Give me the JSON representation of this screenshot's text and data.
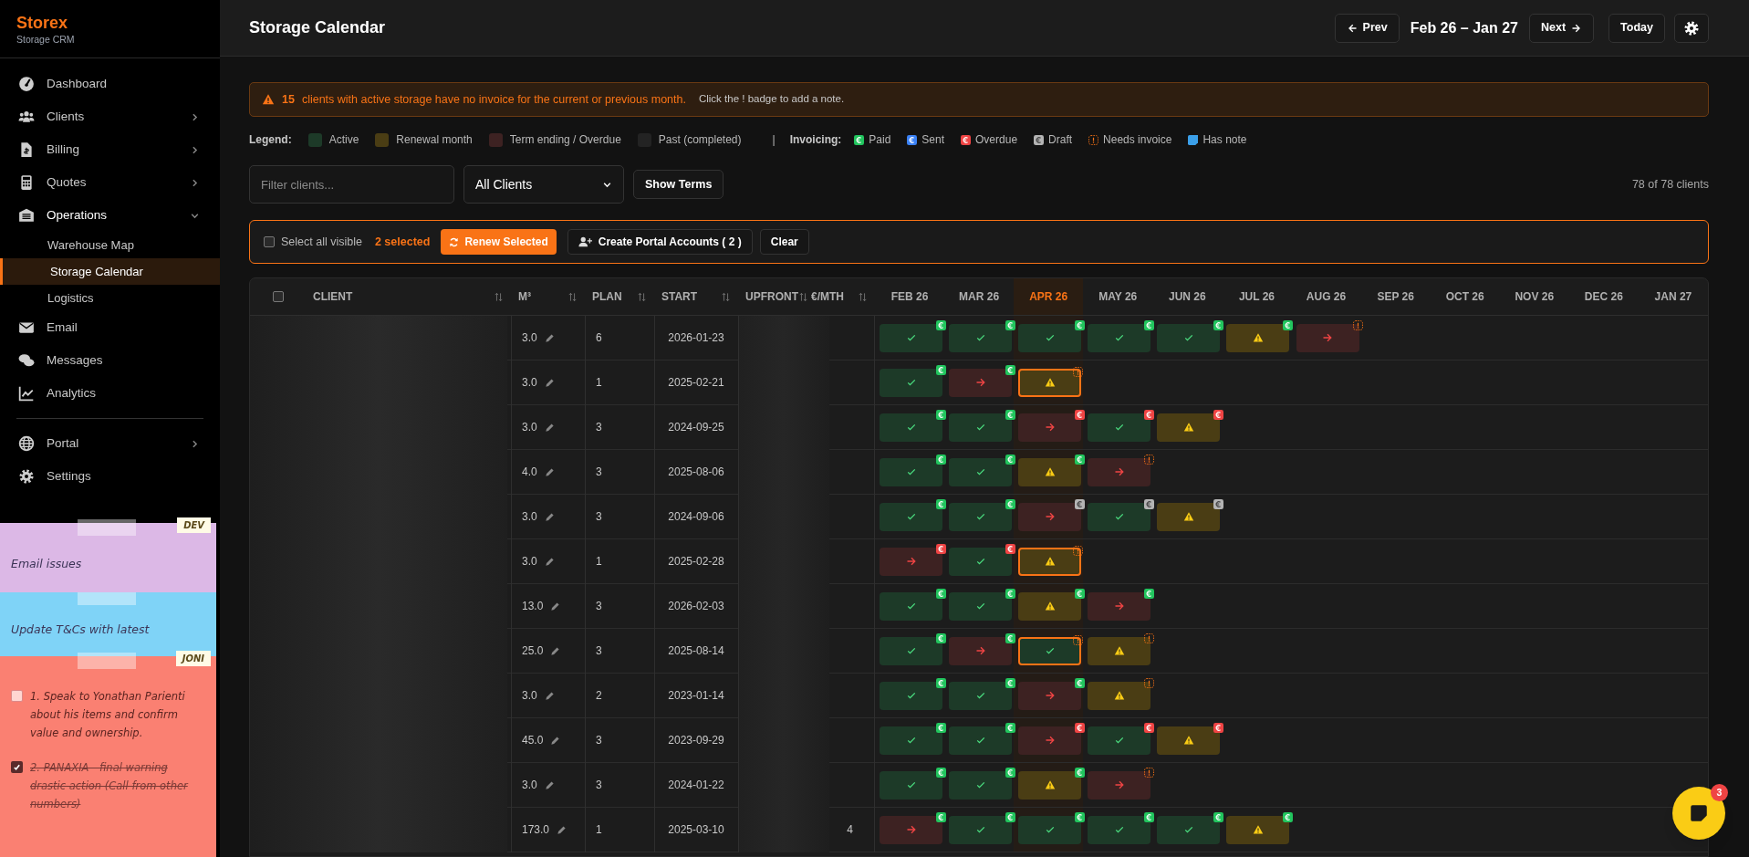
{
  "sidebar": {
    "brand": "Storex",
    "subtitle": "Storage CRM",
    "groups": [
      {
        "items": [
          {
            "label": "Dashboard",
            "selected": false
          },
          {
            "label": "Clients",
            "selected": false,
            "expanded": false
          },
          {
            "label": "Billing",
            "selected": false,
            "expanded": false
          },
          {
            "label": "Quotes",
            "selected": false,
            "expanded": false
          },
          {
            "label": "Operations",
            "selected": false,
            "expanded": true,
            "children": [
              {
                "label": "Warehouse Map",
                "selected": false
              },
              {
                "label": "Storage Calendar",
                "selected": true
              },
              {
                "label": "Logistics",
                "selected": false
              }
            ]
          },
          {
            "label": "Email",
            "selected": false
          },
          {
            "label": "Messages",
            "selected": false
          },
          {
            "label": "Analytics",
            "selected": false
          }
        ]
      },
      {
        "items": [
          {
            "label": "Portal",
            "selected": false,
            "expanded": false
          },
          {
            "label": "Settings",
            "selected": false
          }
        ]
      }
    ]
  },
  "notes": [
    {
      "color": "#dcb8e6",
      "tag": "DEV",
      "text": "Email issues"
    },
    {
      "color": "#7fd3f7",
      "text": "Update T&Cs with latest"
    },
    {
      "color": "#fa8072",
      "tag": "JONI",
      "tasks": [
        {
          "text": "1. Speak to Yonathan Parienti about his items and confirm value and ownership.",
          "checked": false
        },
        {
          "text": "2. PANAXIA - final warning drastic action (Call from other numbers)",
          "checked": true
        }
      ]
    }
  ],
  "header": {
    "title": "Storage Calendar",
    "prev": "Prev",
    "range": "Feb 26 – Jan 27",
    "next": "Next",
    "today": "Today"
  },
  "alert": {
    "count": "15",
    "message": "clients with active storage have no invoice for the current or previous month.",
    "hint": "Click the ! badge to add a note."
  },
  "legend": {
    "label": "Legend:",
    "items": [
      {
        "kind": "active",
        "label": "Active"
      },
      {
        "kind": "renewal",
        "label": "Renewal month"
      },
      {
        "kind": "ending",
        "label": "Term ending / Overdue"
      },
      {
        "kind": "past",
        "label": "Past (completed)"
      }
    ],
    "separator": "|",
    "invoicing_label": "Invoicing:",
    "invoicing": [
      {
        "kind": "paid",
        "label": "Paid"
      },
      {
        "kind": "sent",
        "label": "Sent"
      },
      {
        "kind": "overdue",
        "label": "Overdue"
      },
      {
        "kind": "draft",
        "label": "Draft"
      },
      {
        "kind": "needs",
        "label": "Needs invoice"
      },
      {
        "kind": "note",
        "label": "Has note"
      }
    ]
  },
  "filters": {
    "search_placeholder": "Filter clients...",
    "client_filter": "All Clients",
    "show_terms": "Show Terms",
    "count": "78 of 78 clients"
  },
  "selection": {
    "select_all": "Select all visible",
    "select_all_checked": false,
    "selected_count": "2 selected",
    "renew": "Renew Selected",
    "create_accounts": "Create Portal Accounts ( 2 )",
    "clear": "Clear"
  },
  "table": {
    "header_checked": false,
    "columns": [
      "CLIENT",
      "M³",
      "PLAN",
      "START",
      "UPFRONT",
      "€/MTH"
    ],
    "months": [
      {
        "label": "FEB 26",
        "current": false
      },
      {
        "label": "MAR 26",
        "current": false
      },
      {
        "label": "APR 26",
        "current": true
      },
      {
        "label": "MAY 26",
        "current": false
      },
      {
        "label": "JUN 26",
        "current": false
      },
      {
        "label": "JUL 26",
        "current": false
      },
      {
        "label": "AUG 26",
        "current": false
      },
      {
        "label": "SEP 26",
        "current": false
      },
      {
        "label": "OCT 26",
        "current": false
      },
      {
        "label": "NOV 26",
        "current": false
      },
      {
        "label": "DEC 26",
        "current": false
      },
      {
        "label": "JAN 27",
        "current": false
      }
    ],
    "rows": [
      {
        "m3": "3.0",
        "plan": "6",
        "start": "2026-01-23",
        "cells": [
          {
            "kind": "active",
            "invoice": {
              "kind": "paid"
            },
            "outlined": false
          },
          {
            "kind": "active",
            "invoice": {
              "kind": "paid"
            },
            "outlined": false
          },
          {
            "kind": "active",
            "invoice": {
              "kind": "paid"
            },
            "outlined": false
          },
          {
            "kind": "active",
            "invoice": {
              "kind": "paid"
            },
            "outlined": false
          },
          {
            "kind": "active",
            "invoice": {
              "kind": "paid"
            },
            "outlined": false
          },
          {
            "kind": "renewal",
            "invoice": {
              "kind": "paid"
            },
            "outlined": false
          },
          {
            "kind": "ending",
            "invoice": {
              "kind": "needs"
            },
            "outlined": false
          }
        ]
      },
      {
        "m3": "3.0",
        "plan": "1",
        "start": "2025-02-21",
        "cells": [
          {
            "kind": "active",
            "invoice": {
              "kind": "paid"
            },
            "outlined": false
          },
          {
            "kind": "ending",
            "invoice": {
              "kind": "paid"
            },
            "outlined": false
          },
          {
            "kind": "renewal",
            "invoice": {
              "kind": "needs"
            },
            "outlined": true
          }
        ]
      },
      {
        "m3": "3.0",
        "plan": "3",
        "start": "2024-09-25",
        "cells": [
          {
            "kind": "active",
            "invoice": {
              "kind": "paid"
            },
            "outlined": false
          },
          {
            "kind": "active",
            "invoice": {
              "kind": "paid"
            },
            "outlined": false
          },
          {
            "kind": "ending",
            "invoice": {
              "kind": "overdue"
            },
            "outlined": false
          },
          {
            "kind": "active",
            "invoice": {
              "kind": "overdue"
            },
            "outlined": false
          },
          {
            "kind": "renewal",
            "invoice": {
              "kind": "overdue"
            },
            "outlined": false
          }
        ]
      },
      {
        "m3": "4.0",
        "plan": "3",
        "start": "2025-08-06",
        "cells": [
          {
            "kind": "active",
            "invoice": {
              "kind": "paid"
            },
            "outlined": false
          },
          {
            "kind": "active",
            "invoice": {
              "kind": "paid"
            },
            "outlined": false
          },
          {
            "kind": "renewal",
            "invoice": {
              "kind": "paid"
            },
            "outlined": false
          },
          {
            "kind": "ending",
            "invoice": {
              "kind": "needs"
            },
            "outlined": false
          }
        ]
      },
      {
        "m3": "3.0",
        "plan": "3",
        "start": "2024-09-06",
        "cells": [
          {
            "kind": "active",
            "invoice": {
              "kind": "paid"
            },
            "outlined": false
          },
          {
            "kind": "active",
            "invoice": {
              "kind": "paid"
            },
            "outlined": false
          },
          {
            "kind": "ending",
            "invoice": {
              "kind": "draft"
            },
            "outlined": false
          },
          {
            "kind": "active",
            "invoice": {
              "kind": "draft"
            },
            "outlined": false
          },
          {
            "kind": "renewal",
            "invoice": {
              "kind": "draft"
            },
            "outlined": false
          }
        ]
      },
      {
        "m3": "3.0",
        "plan": "1",
        "start": "2025-02-28",
        "cells": [
          {
            "kind": "ending",
            "invoice": {
              "kind": "overdue"
            },
            "outlined": false
          },
          {
            "kind": "active",
            "invoice": {
              "kind": "overdue"
            },
            "outlined": false
          },
          {
            "kind": "renewal",
            "invoice": {
              "kind": "needs"
            },
            "outlined": true
          }
        ]
      },
      {
        "m3": "13.0",
        "plan": "3",
        "start": "2026-02-03",
        "cells": [
          {
            "kind": "active",
            "invoice": {
              "kind": "paid"
            },
            "outlined": false
          },
          {
            "kind": "active",
            "invoice": {
              "kind": "paid"
            },
            "outlined": false
          },
          {
            "kind": "renewal",
            "invoice": {
              "kind": "paid"
            },
            "outlined": false
          },
          {
            "kind": "ending",
            "invoice": {
              "kind": "paid"
            },
            "outlined": false
          }
        ]
      },
      {
        "m3": "25.0",
        "plan": "3",
        "start": "2025-08-14",
        "cells": [
          {
            "kind": "active",
            "invoice": {
              "kind": "paid"
            },
            "outlined": false
          },
          {
            "kind": "ending",
            "invoice": {
              "kind": "paid"
            },
            "outlined": false
          },
          {
            "kind": "active",
            "invoice": {
              "kind": "needs"
            },
            "outlined": true
          },
          {
            "kind": "renewal",
            "invoice": {
              "kind": "needs"
            },
            "outlined": false
          }
        ]
      },
      {
        "m3": "3.0",
        "plan": "2",
        "start": "2023-01-14",
        "cells": [
          {
            "kind": "active",
            "invoice": {
              "kind": "paid"
            },
            "outlined": false
          },
          {
            "kind": "active",
            "invoice": {
              "kind": "paid"
            },
            "outlined": false
          },
          {
            "kind": "ending",
            "invoice": {
              "kind": "paid"
            },
            "outlined": false
          },
          {
            "kind": "renewal",
            "invoice": {
              "kind": "needs"
            },
            "outlined": false
          }
        ]
      },
      {
        "m3": "45.0",
        "plan": "3",
        "start": "2023-09-29",
        "cells": [
          {
            "kind": "active",
            "invoice": {
              "kind": "paid"
            },
            "outlined": false
          },
          {
            "kind": "active",
            "invoice": {
              "kind": "paid"
            },
            "outlined": false
          },
          {
            "kind": "ending",
            "invoice": {
              "kind": "overdue"
            },
            "outlined": false
          },
          {
            "kind": "active",
            "invoice": {
              "kind": "overdue"
            },
            "outlined": false
          },
          {
            "kind": "renewal",
            "invoice": {
              "kind": "overdue"
            },
            "outlined": false
          }
        ]
      },
      {
        "m3": "3.0",
        "plan": "3",
        "start": "2024-01-22",
        "cells": [
          {
            "kind": "active",
            "invoice": {
              "kind": "paid"
            },
            "outlined": false
          },
          {
            "kind": "active",
            "invoice": {
              "kind": "paid"
            },
            "outlined": false
          },
          {
            "kind": "renewal",
            "invoice": {
              "kind": "paid"
            },
            "outlined": false
          },
          {
            "kind": "ending",
            "invoice": {
              "kind": "needs"
            },
            "outlined": false
          }
        ]
      },
      {
        "m3": "173.0",
        "plan": "1",
        "start": "2025-03-10",
        "per_month": "4",
        "cells": [
          {
            "kind": "ending",
            "invoice": {
              "kind": "paid"
            },
            "outlined": false
          },
          {
            "kind": "active",
            "invoice": {
              "kind": "paid"
            },
            "outlined": false
          },
          {
            "kind": "active",
            "invoice": {
              "kind": "paid"
            },
            "outlined": false
          },
          {
            "kind": "active",
            "invoice": {
              "kind": "paid"
            },
            "outlined": false
          },
          {
            "kind": "active",
            "invoice": {
              "kind": "paid"
            },
            "outlined": false
          },
          {
            "kind": "renewal",
            "invoice": {
              "kind": "paid"
            },
            "outlined": false
          }
        ]
      }
    ]
  },
  "fab": {
    "badge": "3"
  }
}
